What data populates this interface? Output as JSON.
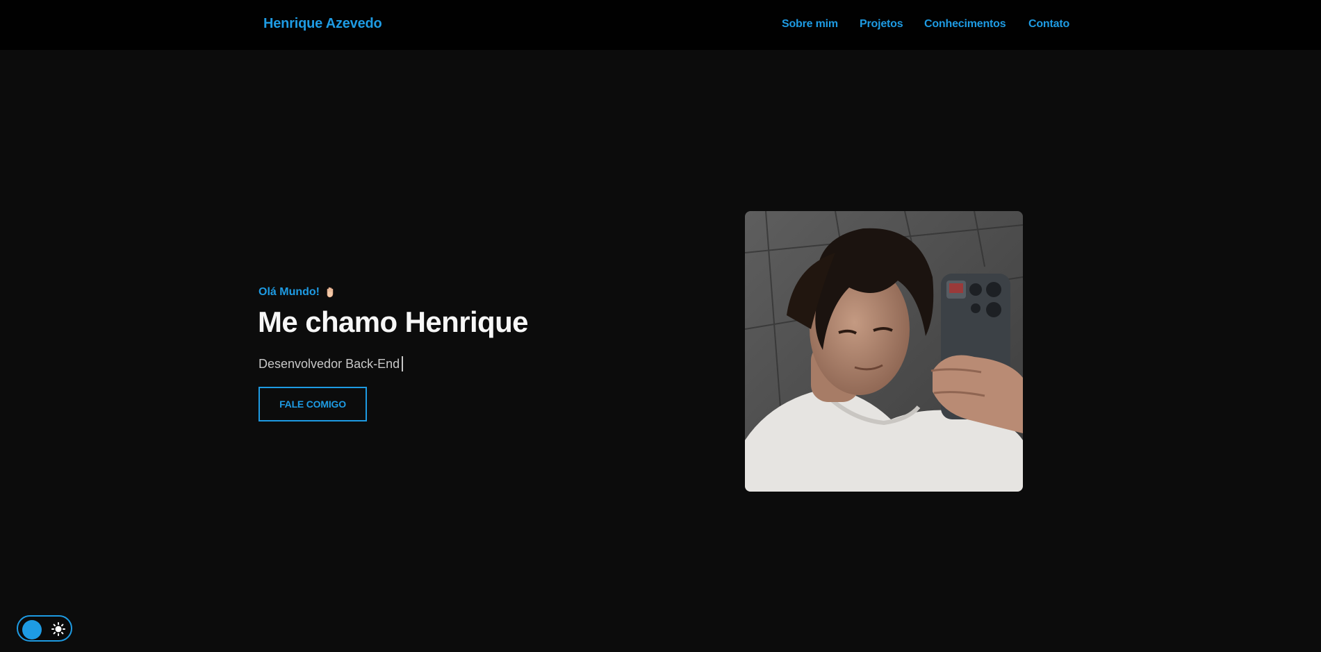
{
  "navbar": {
    "brand": "Henrique Azevedo",
    "links": [
      "Sobre mim",
      "Projetos",
      "Conhecimentos",
      "Contato"
    ]
  },
  "hero": {
    "greeting": "Olá Mundo!",
    "greeting_icon": "waving-hand-icon",
    "title": "Me chamo Henrique",
    "role": "Desenvolvedor Back-End",
    "cta_label": "FALE COMIGO",
    "photo_icon": "profile-photo"
  },
  "theme_toggle": {
    "icon": "sun-icon",
    "state": "dark"
  },
  "colors": {
    "accent": "#1e9be3",
    "background": "#0c0c0c",
    "navbar": "#010101",
    "title": "#f7f7f7",
    "text": "#c8c8c8"
  }
}
